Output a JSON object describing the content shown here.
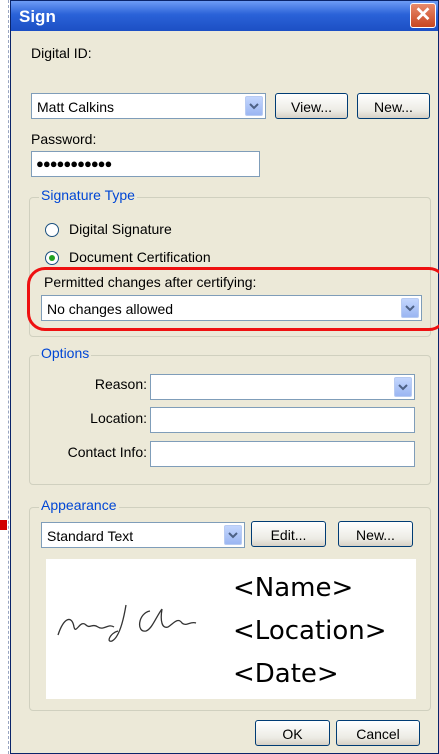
{
  "window": {
    "title": "Sign",
    "close_symbol": "✕"
  },
  "digital_id": {
    "label": "Digital ID:",
    "value": "Matt Calkins",
    "view_label": "View...",
    "new_label": "New..."
  },
  "password": {
    "label": "Password:",
    "value": "●●●●●●●●●●●"
  },
  "signature_type": {
    "legend": "Signature Type",
    "option_digital": "Digital Signature",
    "option_certification": "Document Certification",
    "selected": "Document Certification",
    "permitted_label": "Permitted changes after certifying:",
    "permitted_value": "No changes allowed"
  },
  "options": {
    "legend": "Options",
    "reason_label": "Reason:",
    "reason_value": "",
    "location_label": "Location:",
    "location_value": "",
    "contact_label": "Contact Info:",
    "contact_value": ""
  },
  "appearance": {
    "legend": "Appearance",
    "style_value": "Standard Text",
    "edit_label": "Edit...",
    "new_label": "New...",
    "preview_name": "<Name>",
    "preview_location": "<Location>",
    "preview_date": "<Date>",
    "signature_script": "Matthew J. Calkins"
  },
  "footer": {
    "ok_label": "OK",
    "cancel_label": "Cancel"
  },
  "colors": {
    "accent": "#0046d5",
    "highlight": "#e11111",
    "title_bar": "#2a62d8"
  }
}
